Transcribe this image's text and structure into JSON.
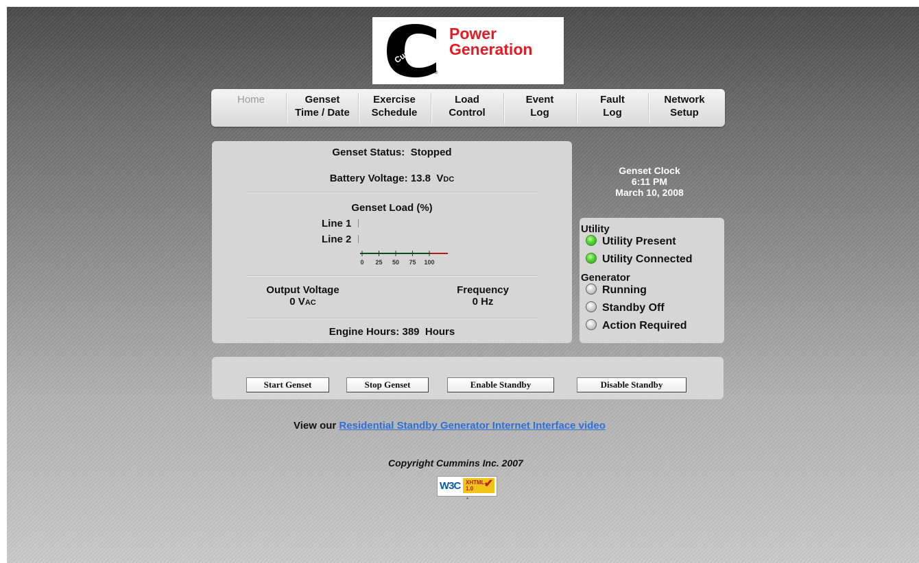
{
  "logo": {
    "line1": "Power",
    "line2": "Generation",
    "mark_text": "Cummins",
    "reg": "®"
  },
  "nav": [
    {
      "l1": "Home",
      "l2": ""
    },
    {
      "l1": "Genset",
      "l2": "Time / Date"
    },
    {
      "l1": "Exercise",
      "l2": "Schedule"
    },
    {
      "l1": "Load",
      "l2": "Control"
    },
    {
      "l1": "Event",
      "l2": "Log"
    },
    {
      "l1": "Fault",
      "l2": "Log"
    },
    {
      "l1": "Network",
      "l2": "Setup"
    }
  ],
  "status": {
    "genset_status_label": "Genset Status:",
    "genset_status_value": "Stopped",
    "battery_label": "Battery Voltage:",
    "battery_value": "13.8",
    "battery_unit_main": "V",
    "battery_unit_sub": "DC",
    "load_title": "Genset Load (%)",
    "line1_label": "Line 1",
    "line2_label": "Line 2",
    "line1_load": 0,
    "line2_load": 0,
    "gauge_ticks": [
      "0",
      "25",
      "50",
      "75",
      "100"
    ],
    "output_voltage_label": "Output Voltage",
    "output_voltage_value": "0",
    "output_voltage_unit_main": "V",
    "output_voltage_unit_sub": "AC",
    "frequency_label": "Frequency",
    "frequency_value": "0 Hz",
    "engine_hours_label": "Engine Hours:",
    "engine_hours_value": "389",
    "engine_hours_unit": "Hours"
  },
  "clock": {
    "title": "Genset Clock",
    "time": "6:11 PM",
    "date": "March 10, 2008"
  },
  "indicators": {
    "utility_head": "Utility",
    "utility_present": "Utility Present",
    "utility_connected": "Utility Connected",
    "generator_head": "Generator",
    "running": "Running",
    "standby_off": "Standby Off",
    "action_required": "Action Required"
  },
  "buttons": {
    "start": "Start Genset",
    "stop": "Stop Genset",
    "enable": "Enable Standby",
    "disable": "Disable Standby"
  },
  "footer": {
    "video_prefix": "View our",
    "video_link": "Residential Standby Generator Internet Interface video",
    "copyright": "Copyright Cummins Inc. 2007",
    "w3c_left": "W3C",
    "w3c_line1": "XHTML",
    "w3c_line2": "1.0"
  },
  "colors": {
    "brand_red": "#e31b23",
    "link_blue": "#2f6fd6",
    "led_green": "#5cd63a"
  }
}
